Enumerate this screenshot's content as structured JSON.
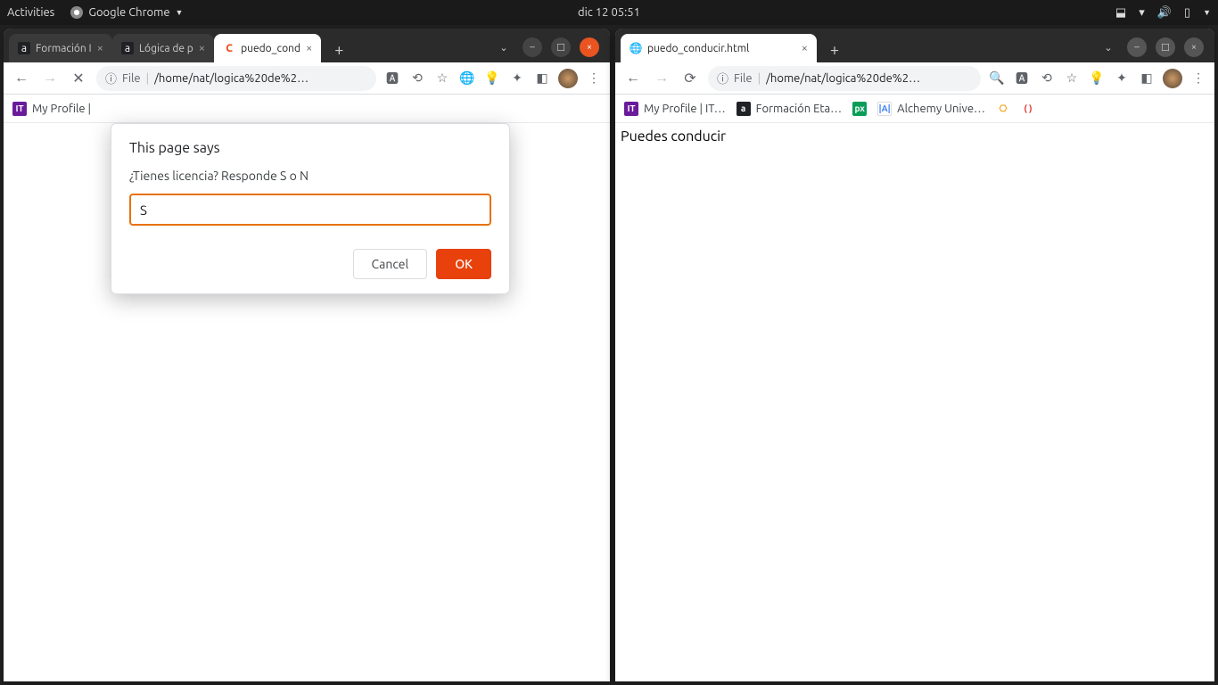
{
  "panel": {
    "activities": "Activities",
    "app": "Google Chrome",
    "clock": "dic 12  05:51"
  },
  "left_window": {
    "tabs": [
      {
        "title": "Formación I"
      },
      {
        "title": "Lógica de p"
      },
      {
        "title": "puedo_cond"
      }
    ],
    "address": {
      "scheme": "File",
      "path": "/home/nat/logica%20de%2…"
    },
    "bookmarks": {
      "profile": "My Profile |"
    },
    "dialog": {
      "heading": "This page says",
      "message": "¿Tienes licencia? Responde S o N",
      "input_value": "S",
      "cancel": "Cancel",
      "ok": "OK"
    }
  },
  "right_window": {
    "tabs": [
      {
        "title": "puedo_conducir.html"
      }
    ],
    "address": {
      "scheme": "File",
      "path": "/home/nat/logica%20de%2…"
    },
    "bookmarks": {
      "profile": "My Profile | IT…",
      "formacion": "Formación Eta…",
      "alchemy": "Alchemy Unive…"
    },
    "page_text": "Puedes conducir"
  }
}
